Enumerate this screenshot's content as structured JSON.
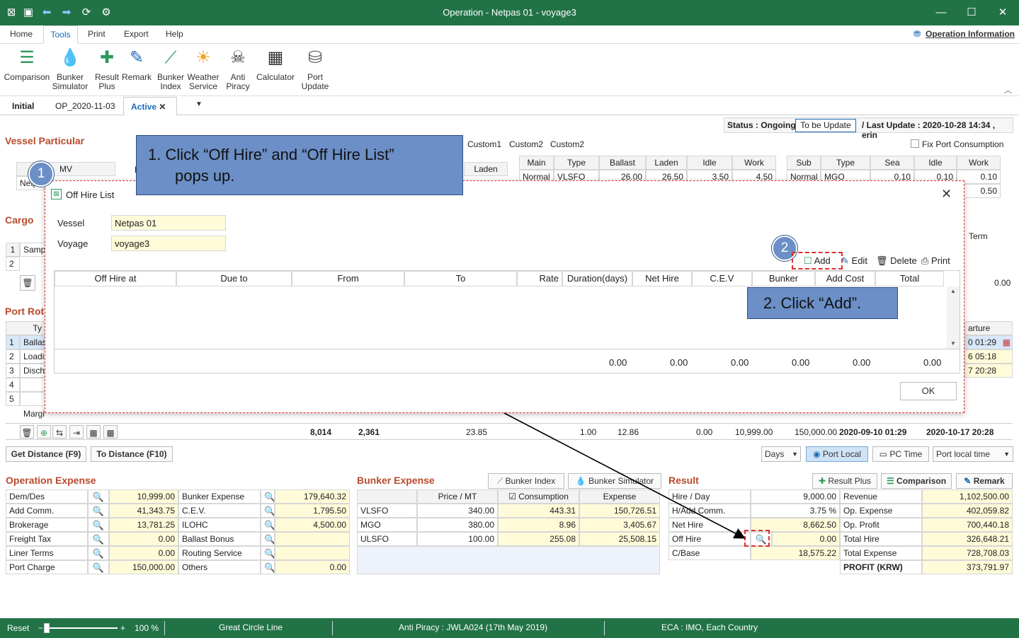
{
  "window": {
    "title": "Operation - Netpas 01 - voyage3"
  },
  "menu": {
    "items": [
      "Home",
      "Tools",
      "Print",
      "Export",
      "Help"
    ],
    "operation_info": "Operation Information"
  },
  "ribbon": [
    {
      "l1": "Comparison",
      "l2": ""
    },
    {
      "l1": "Bunker",
      "l2": "Simulator"
    },
    {
      "l1": "Result",
      "l2": "Plus"
    },
    {
      "l1": "Remark",
      "l2": ""
    },
    {
      "l1": "Bunker",
      "l2": "Index"
    },
    {
      "l1": "Weather",
      "l2": "Service"
    },
    {
      "l1": "Anti",
      "l2": "Piracy"
    },
    {
      "l1": "Calculator",
      "l2": ""
    },
    {
      "l1": "Port",
      "l2": "Update"
    }
  ],
  "tabs": {
    "t1": "Initial",
    "t2": "OP_2020-11-03",
    "t3": "Active"
  },
  "status": {
    "label": "Status : Ongoing",
    "update_btn": "To be Update",
    "last_update": "/ Last Update : 2020-10-28 14:34 , erin"
  },
  "vessel": {
    "title": "Vessel Particular",
    "mv": "MV",
    "d": "D",
    "netp": "Netp",
    "laden": "Laden",
    "custom1": "Custom1",
    "custom2a": "Custom2",
    "custom2b": "Custom2",
    "fix_port": "Fix Port Consumption",
    "main_hdr": [
      "Main",
      "Type",
      "Ballast",
      "Laden",
      "Idle",
      "Work"
    ],
    "main_row": [
      "Normal",
      "VLSFO",
      "26.00",
      "26.50",
      "3.50",
      "4.50"
    ],
    "sub_hdr": [
      "Sub",
      "Type",
      "Sea",
      "Idle",
      "Work"
    ],
    "sub_row": [
      "Normal",
      "MGO",
      "0.10",
      "0.10",
      "0.10"
    ],
    "sub_row2": "0.50"
  },
  "cargo": {
    "title": "Cargo",
    "r1n": "1",
    "r1": "Samp",
    "r2n": "2",
    "term": "Term",
    "zero": "0.00"
  },
  "port": {
    "title": "Port Rot",
    "ty": "Ty",
    "rows": [
      {
        "n": "1",
        "t": "Ballas"
      },
      {
        "n": "2",
        "t": "Loadi"
      },
      {
        "n": "3",
        "t": "Disch"
      },
      {
        "n": "4",
        "t": ""
      },
      {
        "n": "5",
        "t": ""
      }
    ],
    "margin": "Margi",
    "departure": "arture",
    "dep": [
      "0 01:29",
      "6 05:18",
      "7 20:28"
    ],
    "totals": [
      "8,014",
      "2,361",
      "23.85",
      "1.00",
      "12.86",
      "0.00",
      "10,999.00",
      "150,000.00",
      "2020-09-10 01:29",
      "2020-10-17 20:28"
    ]
  },
  "dist": {
    "get": "Get Distance (F9)",
    "to": "To Distance (F10)",
    "days": "Days",
    "port_local": "Port Local",
    "pc_time": "PC Time",
    "port_local_time": "Port local time"
  },
  "opex": {
    "title": "Operation Expense",
    "left": [
      [
        "Dem/Des",
        "10,999.00"
      ],
      [
        "Add Comm.",
        "41,343.75"
      ],
      [
        "Brokerage",
        "13,781.25"
      ],
      [
        "Freight Tax",
        "0.00"
      ],
      [
        "Liner Terms",
        "0.00"
      ],
      [
        "Port Charge",
        "150,000.00"
      ]
    ],
    "right": [
      [
        "Bunker Expense",
        "179,640.32"
      ],
      [
        "C.E.V.",
        "1,795.50"
      ],
      [
        "ILOHC",
        "4,500.00"
      ],
      [
        "Ballast Bonus",
        ""
      ],
      [
        "Routing Service",
        ""
      ],
      [
        "Others",
        "0.00"
      ]
    ]
  },
  "bunker": {
    "title": "Bunker Expense",
    "index_btn": "Bunker Index",
    "sim_btn": "Bunker Simulator",
    "hdr": [
      "",
      "Price / MT",
      "Consumption",
      "Expense"
    ],
    "rows": [
      [
        "VLSFO",
        "340.00",
        "443.31",
        "150,726.51"
      ],
      [
        "MGO",
        "380.00",
        "8.96",
        "3,405.67"
      ],
      [
        "ULSFO",
        "100.00",
        "255.08",
        "25,508.15"
      ]
    ]
  },
  "result": {
    "title": "Result",
    "plus_btn": "Result Plus",
    "comp_btn": "Comparison",
    "remark_btn": "Remark",
    "left": [
      [
        "Hire / Day",
        "9,000.00"
      ],
      [
        "H/Add Comm.",
        "3.75 %"
      ],
      [
        "Net Hire",
        "8,662.50"
      ],
      [
        "Off Hire",
        "0.00"
      ],
      [
        "C/Base",
        "18,575.22"
      ]
    ],
    "right": [
      [
        "Revenue",
        "1,102,500.00"
      ],
      [
        "Op. Expense",
        "402,059.82"
      ],
      [
        "Op. Profit",
        "700,440.18"
      ],
      [
        "Total Hire",
        "326,648.21"
      ],
      [
        "Total Expense",
        "728,708.03"
      ],
      [
        "PROFIT (KRW)",
        "373,791.97"
      ]
    ]
  },
  "statusbar": {
    "reset": "Reset",
    "zoom": "100 %",
    "gcl": "Great Circle Line",
    "piracy": "Anti Piracy : JWLA024 (17th May 2019)",
    "eca": "ECA : IMO, Each Country"
  },
  "dialog": {
    "title": "Off Hire List",
    "vessel_label": "Vessel",
    "vessel": "Netpas 01",
    "voyage_label": "Voyage",
    "voyage": "voyage3",
    "add": "Add",
    "edit": "Edit",
    "delete": "Delete",
    "print": "Print",
    "cols": [
      "Off Hire at",
      "Due to",
      "From",
      "To",
      "Rate",
      "Duration(days)",
      "Net Hire",
      "C.E.V",
      "Bunker",
      "Add Cost",
      "Total"
    ],
    "totals": [
      "0.00",
      "0.00",
      "0.00",
      "0.00",
      "0.00",
      "0.00"
    ],
    "ok": "OK"
  },
  "callouts": {
    "c1_line1": "1.  Click “Off Hire” and “Off Hire List”",
    "c1_line2": "pops up.",
    "c2": "2. Click “Add”.",
    "b1": "1",
    "b2": "2"
  }
}
